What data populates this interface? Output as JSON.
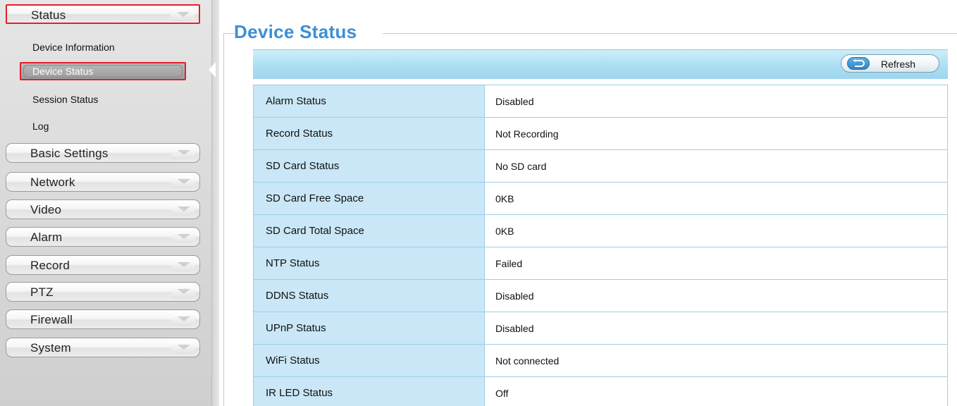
{
  "sidebar": {
    "groups": [
      {
        "label": "Status",
        "active": true
      },
      {
        "label": "Basic Settings"
      },
      {
        "label": "Network"
      },
      {
        "label": "Video"
      },
      {
        "label": "Alarm"
      },
      {
        "label": "Record"
      },
      {
        "label": "PTZ"
      },
      {
        "label": "Firewall"
      },
      {
        "label": "System"
      }
    ],
    "status_items": [
      {
        "label": "Device Information"
      },
      {
        "label": "Device Status",
        "selected": true
      },
      {
        "label": "Session Status"
      },
      {
        "label": "Log"
      }
    ]
  },
  "main": {
    "title": "Device Status",
    "refresh_label": "Refresh",
    "rows": [
      {
        "key": "Alarm Status",
        "value": "Disabled"
      },
      {
        "key": "Record Status",
        "value": "Not Recording"
      },
      {
        "key": "SD Card Status",
        "value": "No SD card"
      },
      {
        "key": "SD Card Free Space",
        "value": "0KB"
      },
      {
        "key": "SD Card Total Space",
        "value": "0KB"
      },
      {
        "key": "NTP Status",
        "value": "Failed"
      },
      {
        "key": "DDNS Status",
        "value": "Disabled"
      },
      {
        "key": "UPnP Status",
        "value": "Disabled"
      },
      {
        "key": "WiFi Status",
        "value": "Not connected"
      },
      {
        "key": "IR LED Status",
        "value": "Off"
      }
    ]
  },
  "colors": {
    "accent_title": "#3c8fd6",
    "highlight_border": "#e0202b",
    "table_key_bg": "#c9e7f6",
    "toolbar_bg": "#aee0f3"
  },
  "icons": {
    "menu_chevron": "chevron-down-icon",
    "refresh": "refresh-icon"
  }
}
